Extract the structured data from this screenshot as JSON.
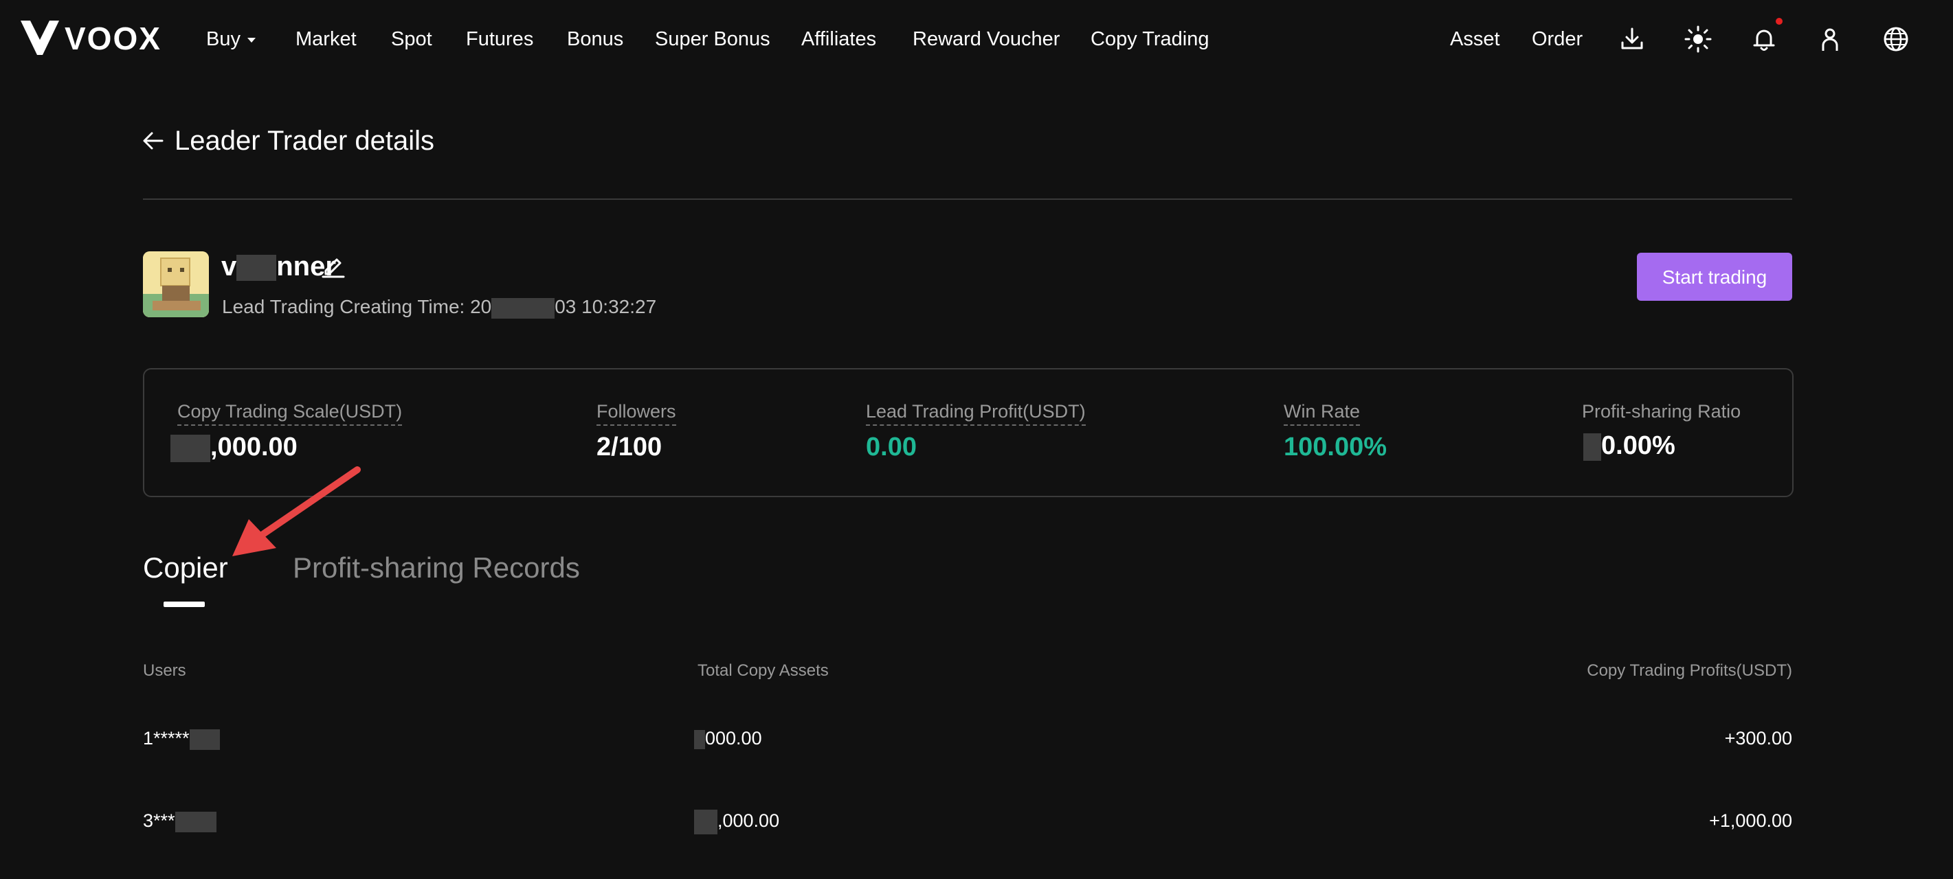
{
  "brand": {
    "name": "VOOX"
  },
  "nav": {
    "items": [
      "Buy",
      "Market",
      "Spot",
      "Futures",
      "Bonus",
      "Super Bonus",
      "Affiliates",
      "Reward Voucher",
      "Copy Trading"
    ],
    "asset_label": "Asset",
    "order_label": "Order",
    "icons": [
      "download-icon",
      "theme-sun-icon",
      "bell-icon",
      "user-icon",
      "globe-icon"
    ]
  },
  "page": {
    "title": "Leader Trader details"
  },
  "trader": {
    "name_prefix": "v",
    "name_suffix": "nner",
    "created_label": "Lead Trading Creating Time: 20",
    "created_suffix": "03 10:32:27",
    "start_button": "Start trading"
  },
  "stats": [
    {
      "label": "Copy Trading Scale(USDT)",
      "value": ",000.00",
      "color": "#ffffff"
    },
    {
      "label": "Followers",
      "value": "2/100",
      "color": "#ffffff"
    },
    {
      "label": "Lead Trading Profit(USDT)",
      "value": "0.00",
      "color": "#1fb895"
    },
    {
      "label": "Win Rate",
      "value": "100.00%",
      "color": "#1fb895"
    },
    {
      "label": "Profit-sharing Ratio",
      "value": "0.00%",
      "color": "#ffffff"
    }
  ],
  "tabs": [
    {
      "label": "Copier",
      "active": true
    },
    {
      "label": "Profit-sharing Records",
      "active": false
    }
  ],
  "table": {
    "headers": [
      "Users",
      "Total Copy Assets",
      "Copy Trading Profits(USDT)"
    ],
    "rows": [
      {
        "user": "1*****",
        "assets": "000.00",
        "profit": "+300.00"
      },
      {
        "user": "3***",
        "assets": ",000.00",
        "profit": "+1,000.00"
      }
    ]
  },
  "colors": {
    "accent": "#a56bf0",
    "profit": "#1fb895",
    "background": "#111111",
    "annotation_arrow": "#e84545"
  }
}
